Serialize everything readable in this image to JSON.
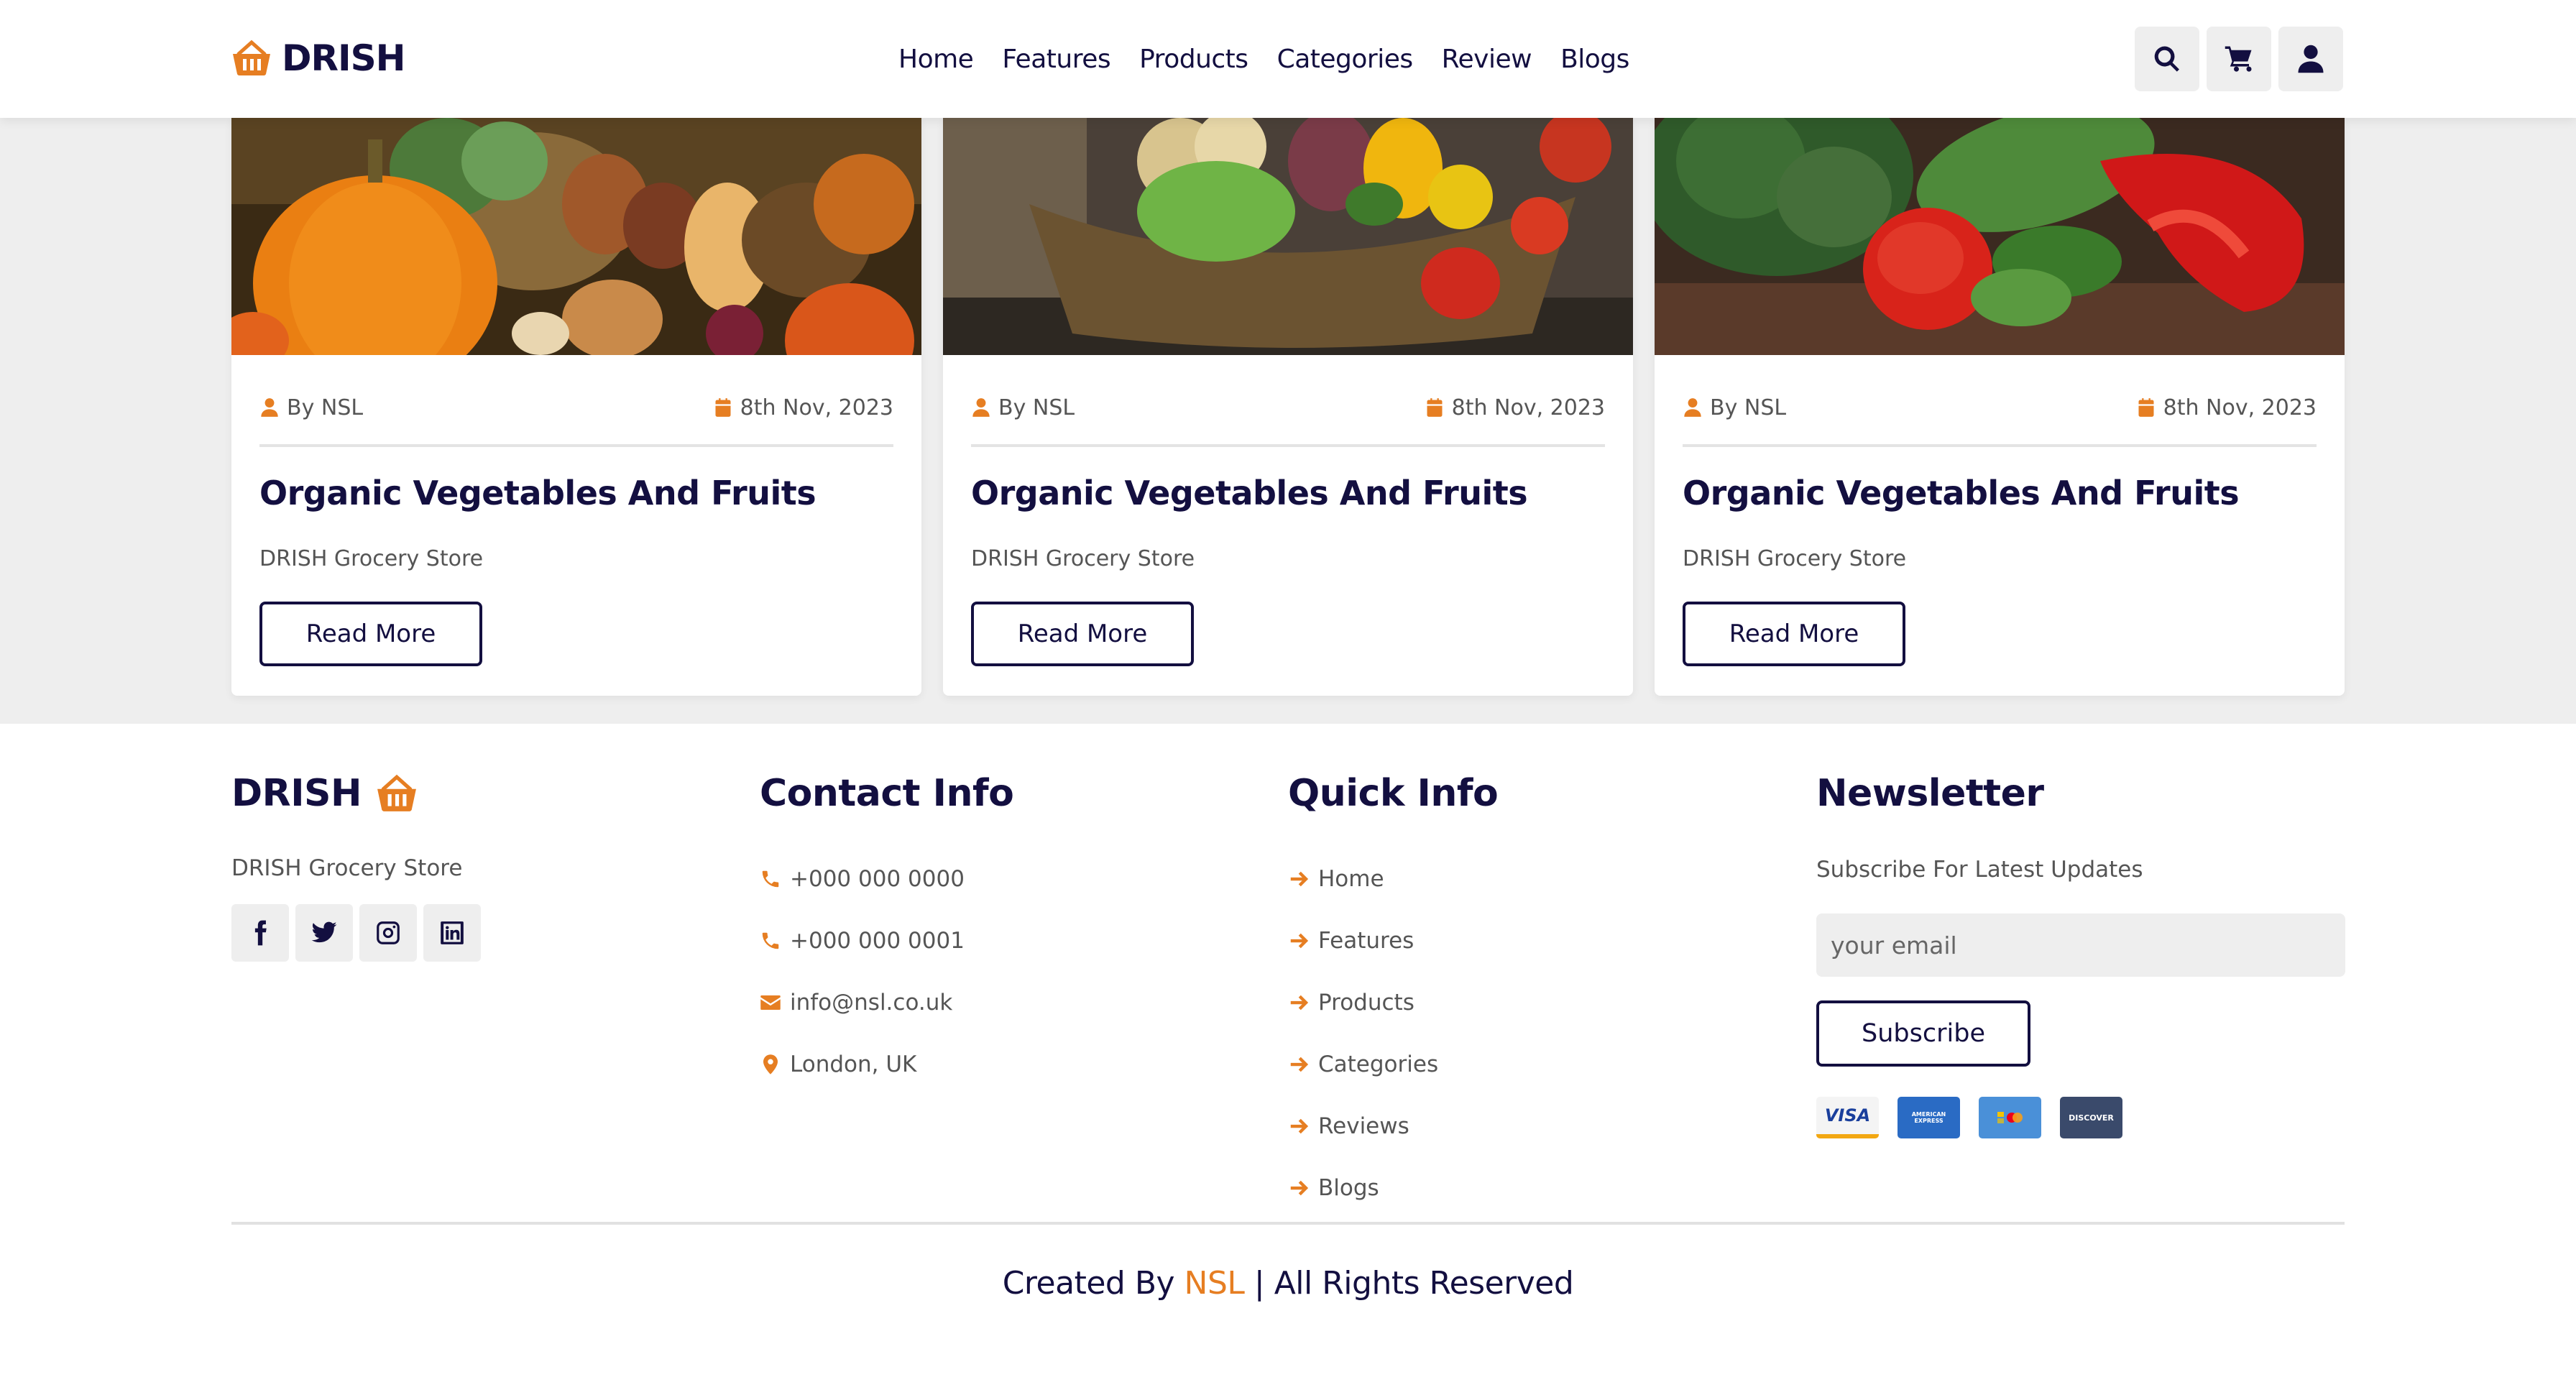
{
  "header": {
    "logo_text": "DRISH",
    "nav": [
      "Home",
      "Features",
      "Products",
      "Categories",
      "Review",
      "Blogs"
    ],
    "icons": [
      "search-icon",
      "cart-icon",
      "user-icon"
    ]
  },
  "blogs": [
    {
      "author": "By NSL",
      "date": "8th Nov, 2023",
      "title": "Organic Vegetables And Fruits",
      "subtitle": "DRISH Grocery Store",
      "button": "Read More"
    },
    {
      "author": "By NSL",
      "date": "8th Nov, 2023",
      "title": "Organic Vegetables And Fruits",
      "subtitle": "DRISH Grocery Store",
      "button": "Read More"
    },
    {
      "author": "By NSL",
      "date": "8th Nov, 2023",
      "title": "Organic Vegetables And Fruits",
      "subtitle": "DRISH Grocery Store",
      "button": "Read More"
    }
  ],
  "footer": {
    "brand": {
      "title": "DRISH",
      "subtitle": "DRISH Grocery Store",
      "socials": [
        "facebook-icon",
        "twitter-icon",
        "instagram-icon",
        "linkedin-icon"
      ]
    },
    "contact": {
      "title": "Contact Info",
      "items": [
        "+000 000 0000",
        "+000 000 0001",
        "info@nsl.co.uk",
        "London, UK"
      ]
    },
    "quick": {
      "title": "Quick Info",
      "items": [
        "Home",
        "Features",
        "Products",
        "Categories",
        "Reviews",
        "Blogs"
      ]
    },
    "newsletter": {
      "title": "Newsletter",
      "subtitle": "Subscribe For Latest Updates",
      "placeholder": "your email",
      "button": "Subscribe",
      "payment_cards": [
        "VISA",
        "AMERICAN EXPRESS",
        "",
        "DISCOVER"
      ]
    },
    "credit": {
      "prefix": "Created By ",
      "highlight": "NSL",
      "suffix": " | All Rights Reserved"
    }
  },
  "colors": {
    "accent": "#e67e22",
    "navy": "#130f40",
    "section_bg": "#eeeeee"
  }
}
